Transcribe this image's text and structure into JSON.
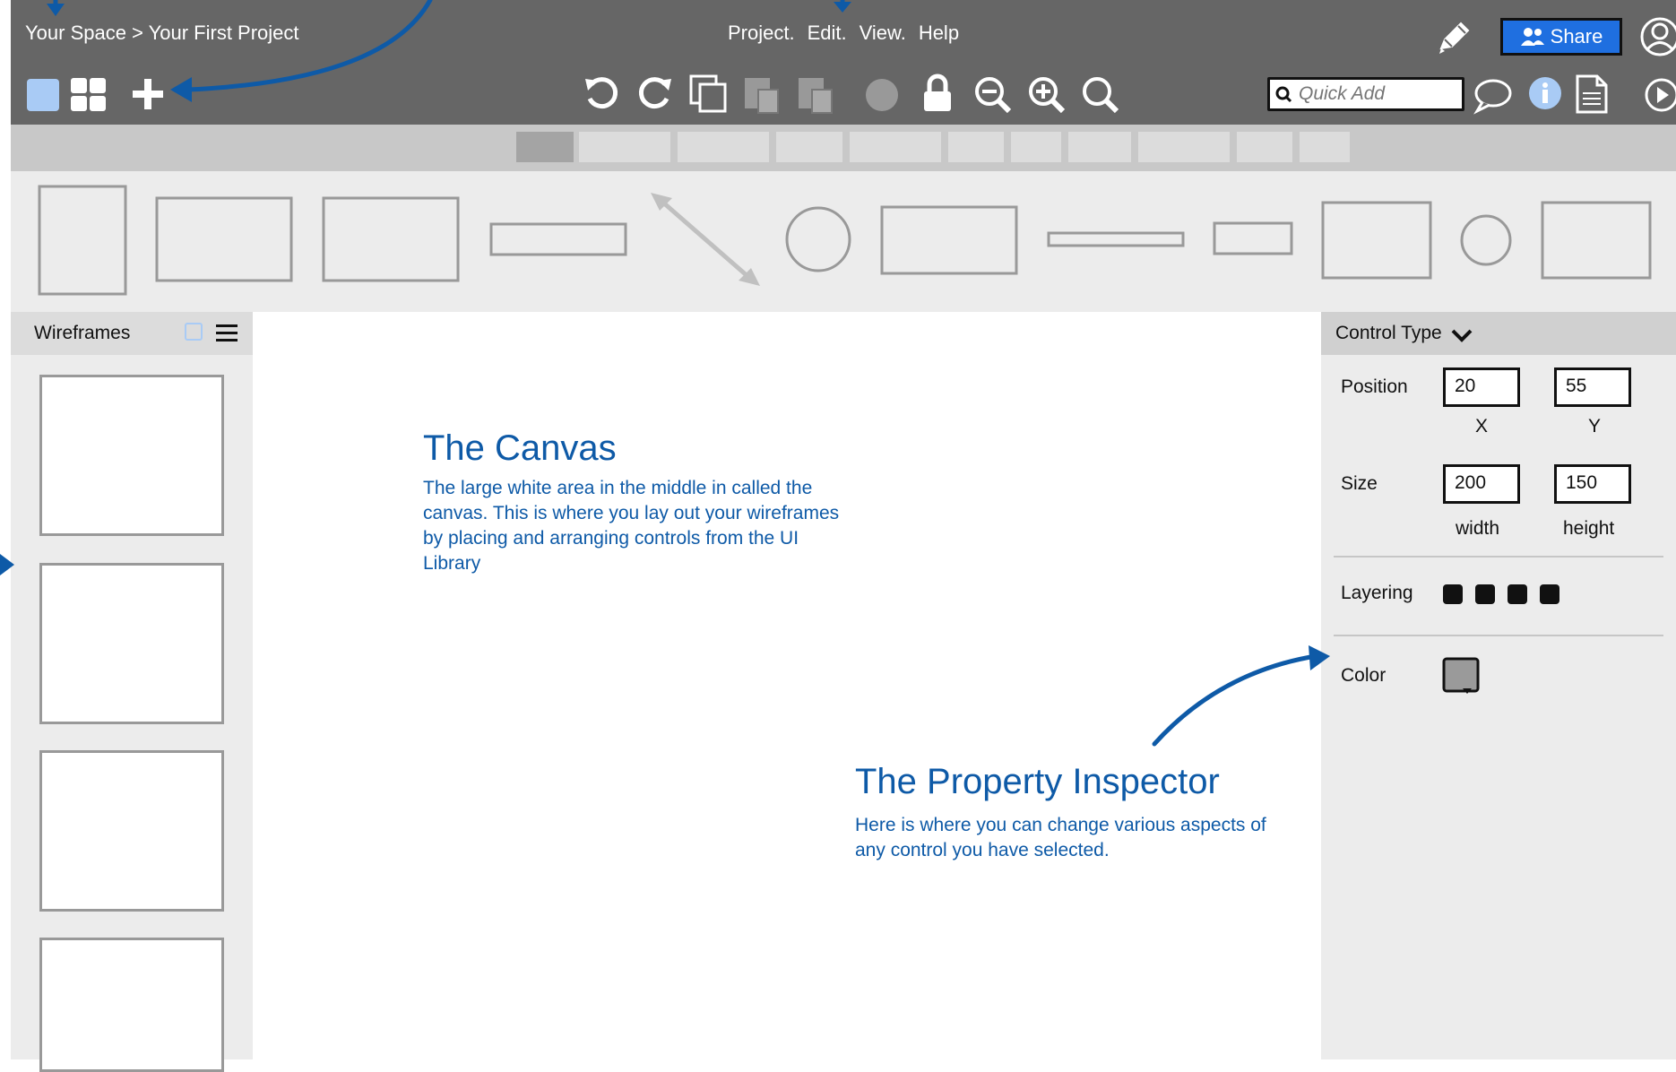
{
  "topbar": {
    "breadcrumb": "Your Space > Your First Project",
    "menu": [
      "Project.",
      "Edit.",
      "View.",
      "Help"
    ],
    "share_label": "Share",
    "quick_add_placeholder": "Quick Add"
  },
  "left_panel": {
    "title": "Wireframes"
  },
  "inspector": {
    "header": "Control Type",
    "position_label": "Position",
    "x_value": "20",
    "y_value": "55",
    "x_caption": "X",
    "y_caption": "Y",
    "size_label": "Size",
    "width_value": "200",
    "height_value": "150",
    "width_caption": "width",
    "height_caption": "height",
    "layering_label": "Layering",
    "color_label": "Color"
  },
  "notes": {
    "canvas_title": "The Canvas",
    "canvas_body": "The large white area in the middle in called the canvas. This is where you lay out your wireframes by placing and arranging controls from the UI Library",
    "inspector_title": "The Property Inspector",
    "inspector_body": "Here is where you can change various aspects of any control you have selected."
  },
  "colors": {
    "accent": "#0e5aa7",
    "share_button": "#1f6fe0",
    "topbar": "#666666"
  },
  "icons": [
    "pencil-icon",
    "share-users-icon",
    "user-avatar-icon",
    "single-view-icon",
    "grid-view-icon",
    "add-icon",
    "undo-icon",
    "redo-icon",
    "duplicate-icon",
    "paste-icon",
    "paste-special-icon",
    "circle-icon",
    "lock-icon",
    "zoom-out-icon",
    "zoom-in-icon",
    "search-icon",
    "comment-icon",
    "info-icon",
    "document-icon",
    "play-icon"
  ]
}
